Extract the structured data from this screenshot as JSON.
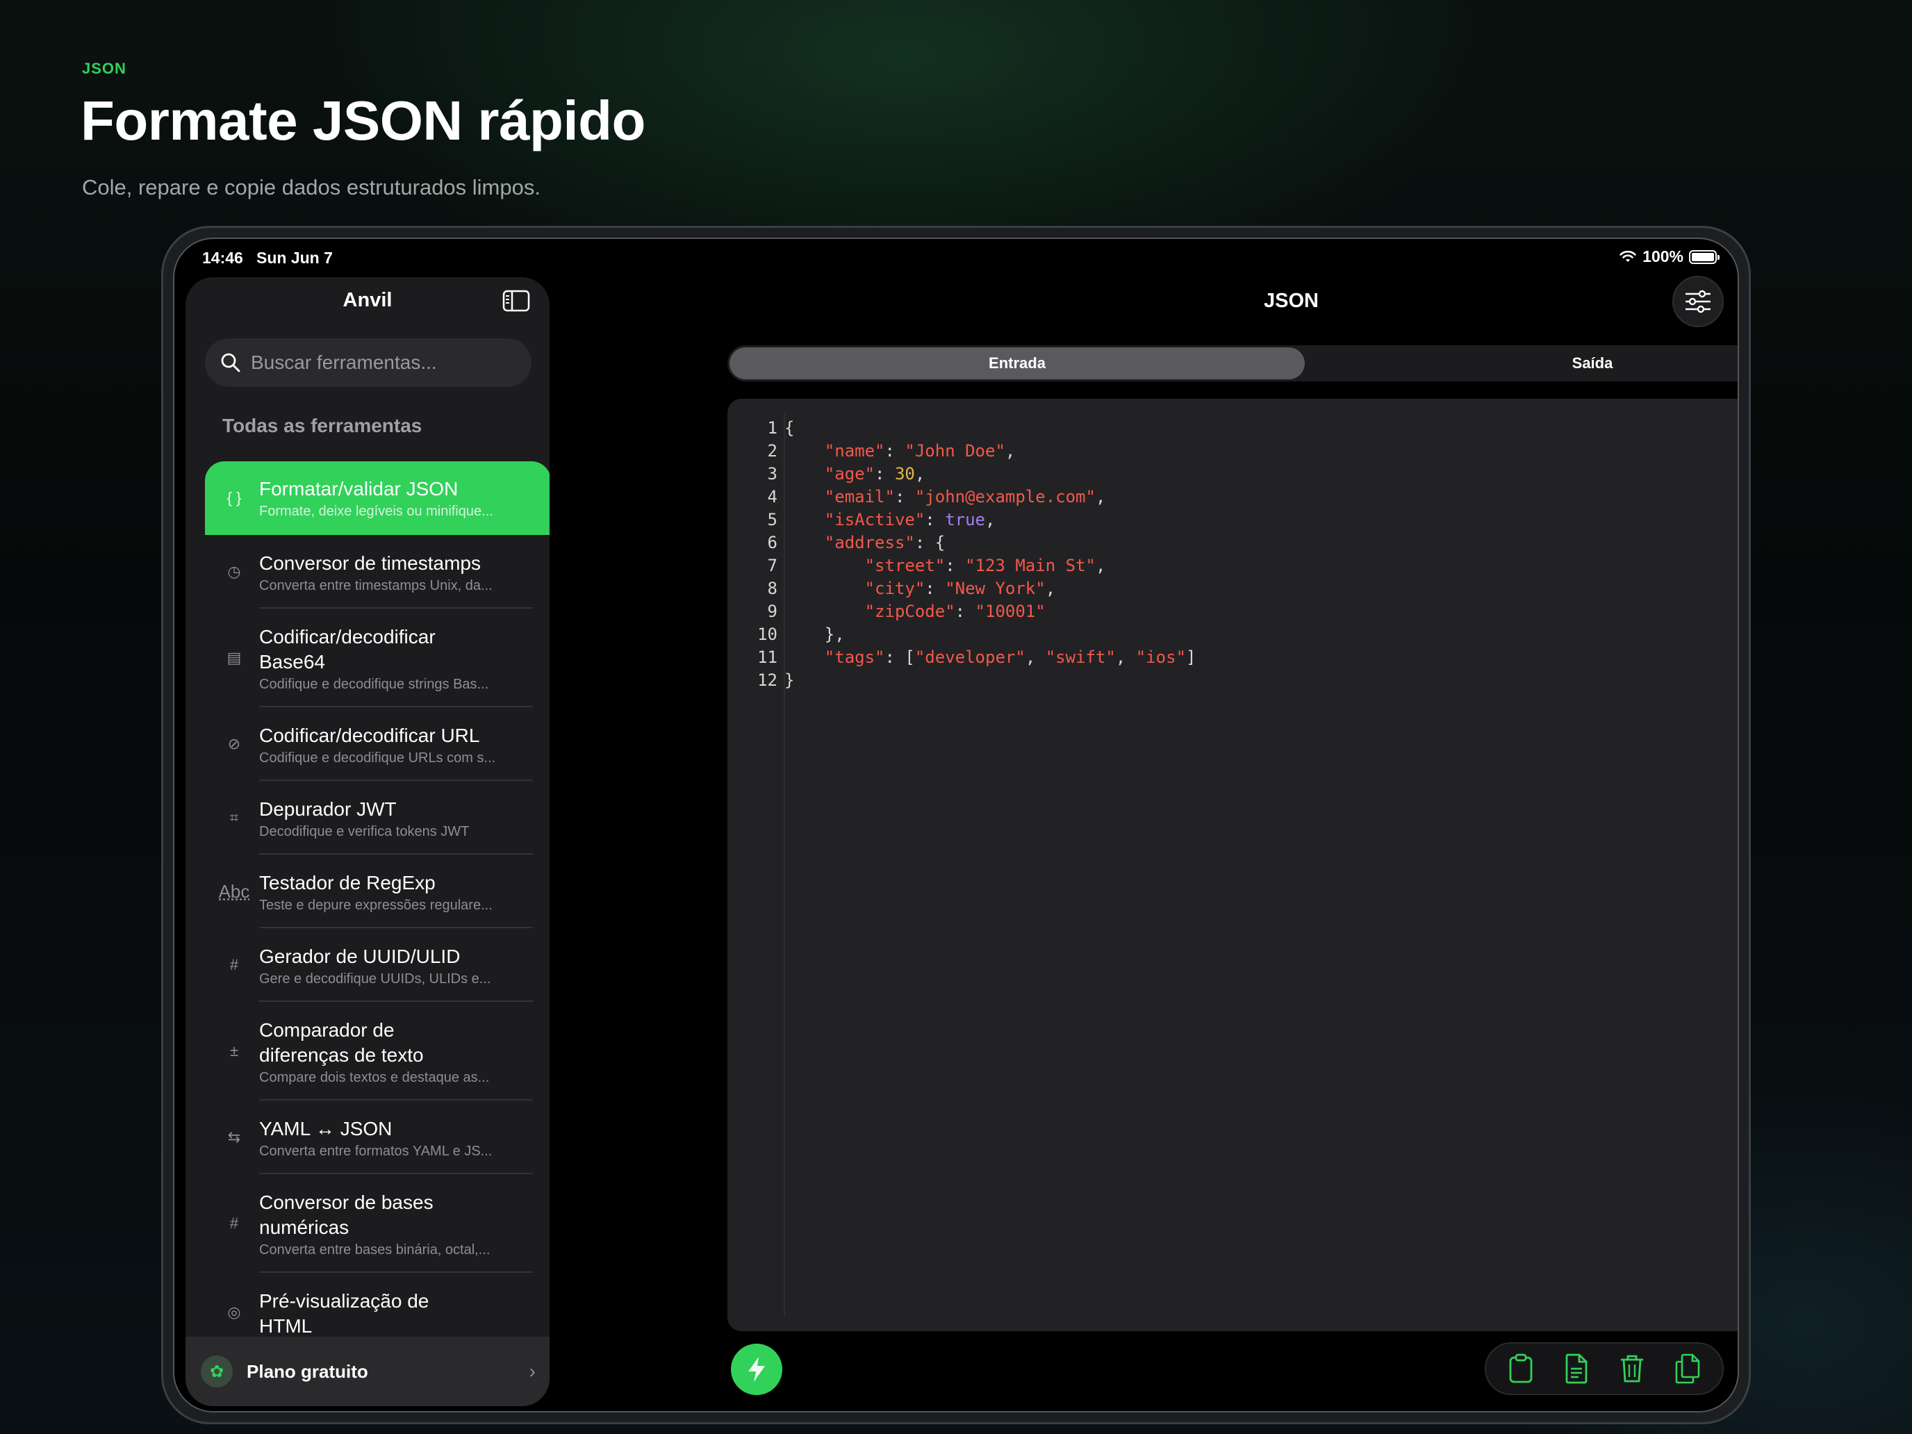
{
  "hero": {
    "eyebrow": "JSON",
    "title": "Formate JSON rápido",
    "subtitle": "Cole, repare e copie dados estruturados limpos."
  },
  "status_bar": {
    "time": "14:46",
    "date": "Sun Jun 7",
    "battery": "100%"
  },
  "sidebar": {
    "title": "Anvil",
    "search_placeholder": "Buscar ferramentas...",
    "section_title": "Todas as ferramentas",
    "items": [
      {
        "name": "Formatar/validar JSON",
        "desc": "Formate, deixe legíveis ou minifique...",
        "icon": "braces-icon",
        "glyph": "{ }"
      },
      {
        "name": "Conversor de timestamps",
        "desc": "Converta entre timestamps Unix, da...",
        "icon": "clock-check-icon",
        "glyph": "◷"
      },
      {
        "name": "Codificar/decodificar Base64",
        "desc": "Codifique e decodifique strings Bas...",
        "icon": "document-search-icon",
        "glyph": "▤"
      },
      {
        "name": "Codificar/decodificar URL",
        "desc": "Codifique e decodifique URLs com s...",
        "icon": "link-icon",
        "glyph": "⊘"
      },
      {
        "name": "Depurador JWT",
        "desc": "Decodifique e verifica tokens JWT",
        "icon": "key-frame-icon",
        "glyph": "⌗"
      },
      {
        "name": "Testador de RegExp",
        "desc": "Teste e depure expressões regulare...",
        "icon": "abc-icon",
        "glyph": "Abc"
      },
      {
        "name": "Gerador de UUID/ULID",
        "desc": "Gere e decodifique UUIDs, ULIDs e...",
        "icon": "hash-square-icon",
        "glyph": "#"
      },
      {
        "name": "Comparador de diferenças de texto",
        "desc": "Compare dois textos e destaque as...",
        "icon": "diff-document-icon",
        "glyph": "±"
      },
      {
        "name": "YAML ↔ JSON",
        "desc": "Converta entre formatos YAML e JS...",
        "icon": "convert-arrows-icon",
        "glyph": "⇆"
      },
      {
        "name": "Conversor de bases numéricas",
        "desc": "Converta entre bases binária, octal,...",
        "icon": "hash-filled-icon",
        "glyph": "#"
      },
      {
        "name": "Pré-visualização de HTML",
        "desc": "",
        "icon": "compass-icon",
        "glyph": "◎"
      }
    ],
    "footer_label": "Plano gratuito"
  },
  "main": {
    "title": "JSON",
    "tabs": [
      "Entrada",
      "Saída"
    ],
    "active_tab": "Entrada"
  },
  "editor": {
    "lines": [
      "{",
      "    \"name\": \"John Doe\",",
      "    \"age\": 30,",
      "    \"email\": \"john@example.com\",",
      "    \"isActive\": true,",
      "    \"address\": {",
      "        \"street\": \"123 Main St\",",
      "        \"city\": \"New York\",",
      "        \"zipCode\": \"10001\"",
      "    },",
      "    \"tags\": [\"developer\", \"swift\", \"ios\"]",
      "}"
    ]
  },
  "colors": {
    "accent": "#32d15a",
    "key": "#f2584b",
    "number": "#e0b84a",
    "boolean": "#a57cf0"
  }
}
